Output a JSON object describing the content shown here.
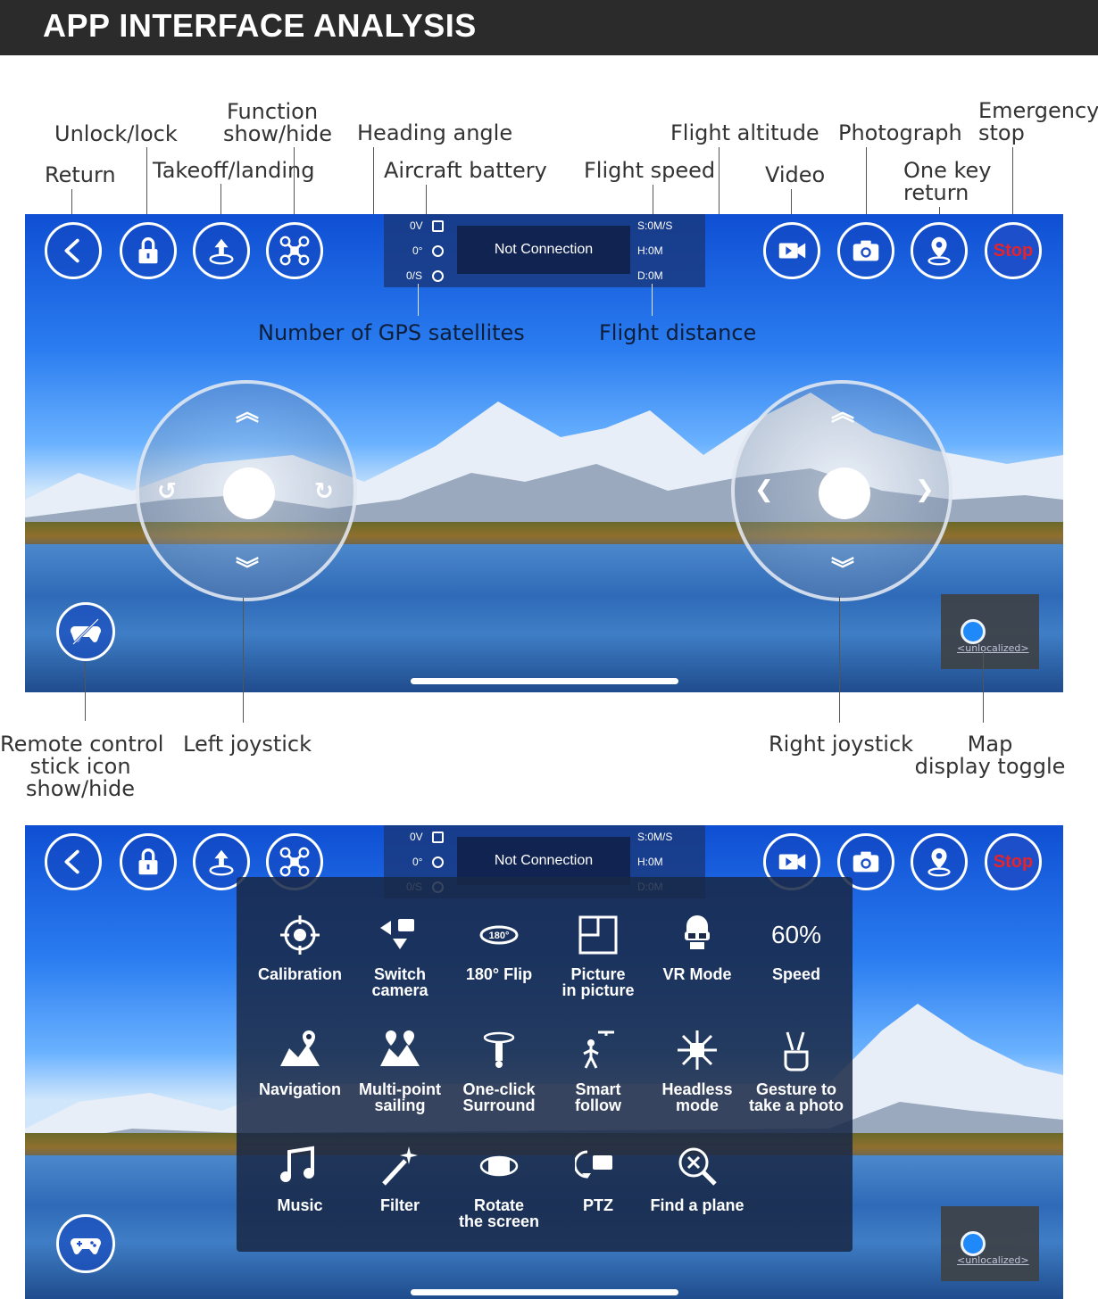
{
  "header": {
    "title": "APP INTERFACE ANALYSIS"
  },
  "annotations": {
    "unlock_lock": "Unlock/lock",
    "function_line1": "Function",
    "function_line2": "show/hide",
    "heading_angle": "Heading angle",
    "flight_altitude": "Flight altitude",
    "photograph": "Photograph",
    "emergency_line1": "Emergency",
    "emergency_line2": "stop",
    "return": "Return",
    "takeoff_landing": "Takeoff/landing",
    "aircraft_battery": "Aircraft battery",
    "flight_speed": "Flight speed",
    "video": "Video",
    "one_key_line1": "One key",
    "one_key_line2": "return",
    "gps_satellites": "Number of GPS satellites",
    "flight_distance": "Flight distance",
    "remote_line1": "Remote control",
    "remote_line2": "stick icon",
    "remote_line3": "show/hide",
    "left_joystick": "Left joystick",
    "right_joystick": "Right joystick",
    "map_line1": "Map",
    "map_line2": "display toggle"
  },
  "status": {
    "connection": "Not Connection",
    "battery": "0V",
    "heading": "0°",
    "satellites": "0/S",
    "speed": "S:0M/S",
    "altitude": "H:0M",
    "distance": "D:0M"
  },
  "controls": {
    "stop_label": "Stop"
  },
  "minimap": {
    "label": "<unlocalized>"
  },
  "functions": [
    {
      "label1": "Calibration",
      "label2": "",
      "icon": "calibration-icon"
    },
    {
      "label1": "Switch",
      "label2": "camera",
      "icon": "switch-camera-icon"
    },
    {
      "label1": "180° Flip",
      "label2": "",
      "icon": "flip-180-icon"
    },
    {
      "label1": "Picture",
      "label2": "in picture",
      "icon": "picture-in-picture-icon"
    },
    {
      "label1": "VR Mode",
      "label2": "",
      "icon": "vr-mode-icon"
    },
    {
      "label1": "Speed",
      "label2": "",
      "icon": "speed-icon",
      "value": "60%"
    },
    {
      "label1": "Navigation",
      "label2": "",
      "icon": "navigation-icon"
    },
    {
      "label1": "Multi-point",
      "label2": "sailing",
      "icon": "multi-point-icon"
    },
    {
      "label1": "One-click",
      "label2": "Surround",
      "icon": "surround-icon"
    },
    {
      "label1": "Smart",
      "label2": "follow",
      "icon": "smart-follow-icon"
    },
    {
      "label1": "Headless",
      "label2": "mode",
      "icon": "headless-icon"
    },
    {
      "label1": "Gesture to",
      "label2": "take a photo",
      "icon": "gesture-icon"
    },
    {
      "label1": "Music",
      "label2": "",
      "icon": "music-icon"
    },
    {
      "label1": "Filter",
      "label2": "",
      "icon": "filter-icon"
    },
    {
      "label1": "Rotate",
      "label2": "the screen",
      "icon": "rotate-screen-icon"
    },
    {
      "label1": "PTZ",
      "label2": "",
      "icon": "ptz-icon"
    },
    {
      "label1": "Find a plane",
      "label2": "",
      "icon": "find-plane-icon"
    }
  ]
}
